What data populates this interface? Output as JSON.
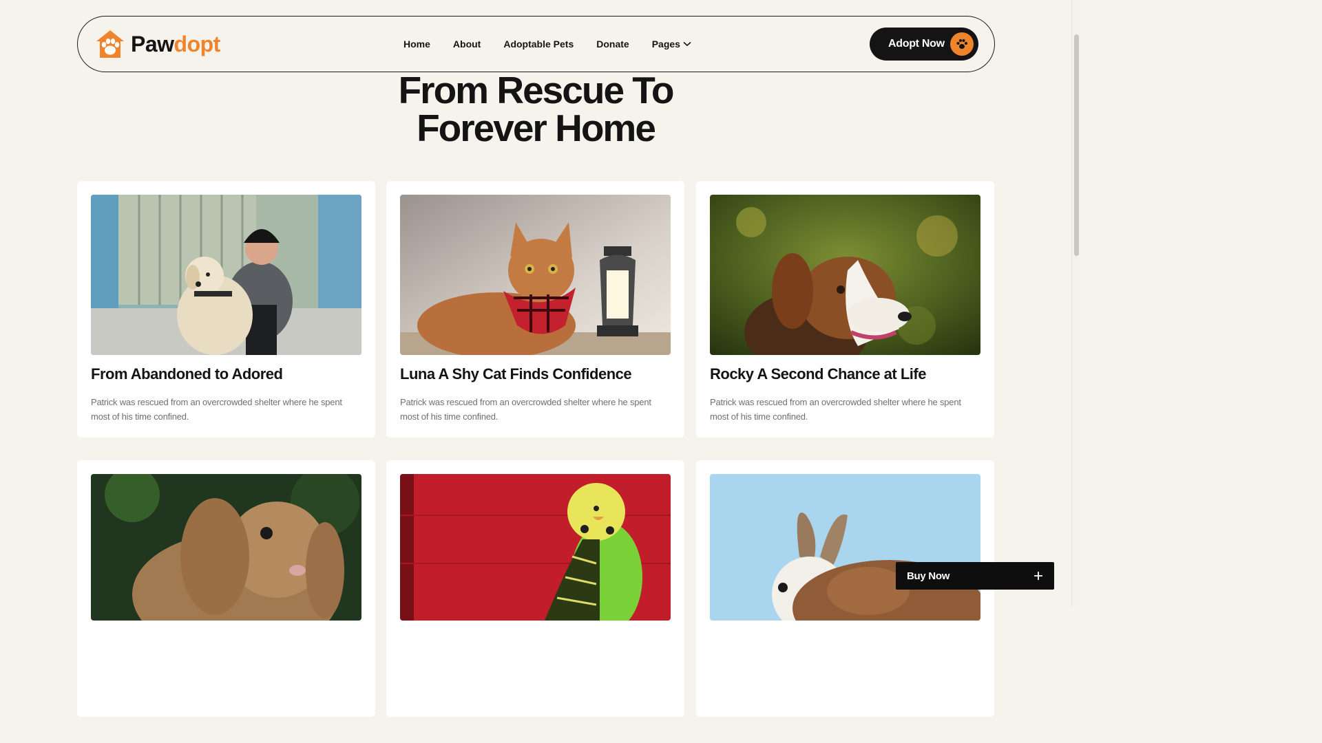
{
  "brand": {
    "name_part_a": "Paw",
    "name_part_b": "dopt",
    "accent_color": "#f0842c",
    "logo_icon": "paw-house-icon"
  },
  "nav": {
    "items": [
      {
        "label": "Home"
      },
      {
        "label": "About"
      },
      {
        "label": "Adoptable Pets"
      },
      {
        "label": "Donate"
      },
      {
        "label": "Pages",
        "icon": "chevron-down-icon"
      }
    ]
  },
  "header_cta": {
    "label": "Adopt Now",
    "icon": "paw-icon"
  },
  "hero": {
    "title_line1": "From Rescue To",
    "title_line2": "Forever Home"
  },
  "stories": [
    {
      "title": "From Abandoned to Adored",
      "excerpt": "Patrick was rescued from an overcrowded shelter where he spent most of his time confined.",
      "image": "woman-with-golden-retriever-photo"
    },
    {
      "title": "Luna A Shy Cat Finds Confidence",
      "excerpt": "Patrick was rescued from an overcrowded shelter where he spent most of his time confined.",
      "image": "tabby-cat-with-bandana-photo"
    },
    {
      "title": "Rocky A Second Chance at Life",
      "excerpt": "Patrick was rescued from an overcrowded shelter where he spent most of his time confined.",
      "image": "beagle-photo"
    },
    {
      "title": "",
      "excerpt": "",
      "image": "lop-rabbit-photo"
    },
    {
      "title": "",
      "excerpt": "",
      "image": "budgie-parrot-photo"
    },
    {
      "title": "",
      "excerpt": "",
      "image": "brown-rabbit-photo"
    }
  ],
  "buy_now": {
    "label": "Buy Now",
    "icon": "plus-icon"
  }
}
